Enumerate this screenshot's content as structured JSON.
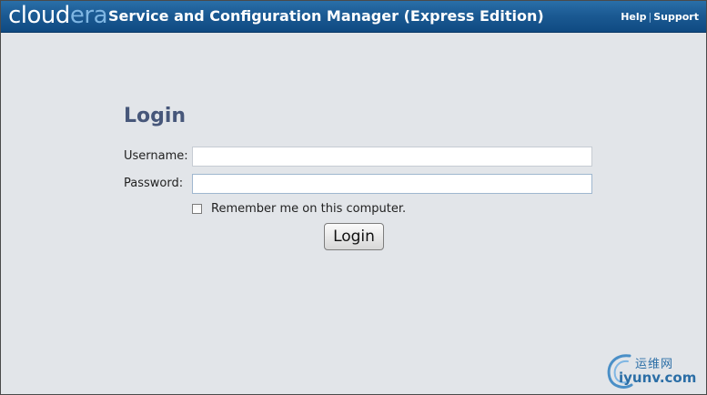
{
  "header": {
    "logo_main": "cloud",
    "logo_accent": "era",
    "title": "Service and Configuration Manager (Express Edition)",
    "links": {
      "help": "Help",
      "separator": "|",
      "support": "Support"
    }
  },
  "login": {
    "heading": "Login",
    "username_label": "Username:",
    "username_value": "",
    "password_label": "Password:",
    "password_value": "",
    "remember_label": "Remember me on this computer.",
    "remember_checked": false,
    "submit_label": "Login"
  },
  "watermark": {
    "chinese": "运维网",
    "url": "iyunv.com"
  },
  "colors": {
    "header": "#1b5a93",
    "background": "#e2e5e9",
    "heading": "#47577a"
  }
}
